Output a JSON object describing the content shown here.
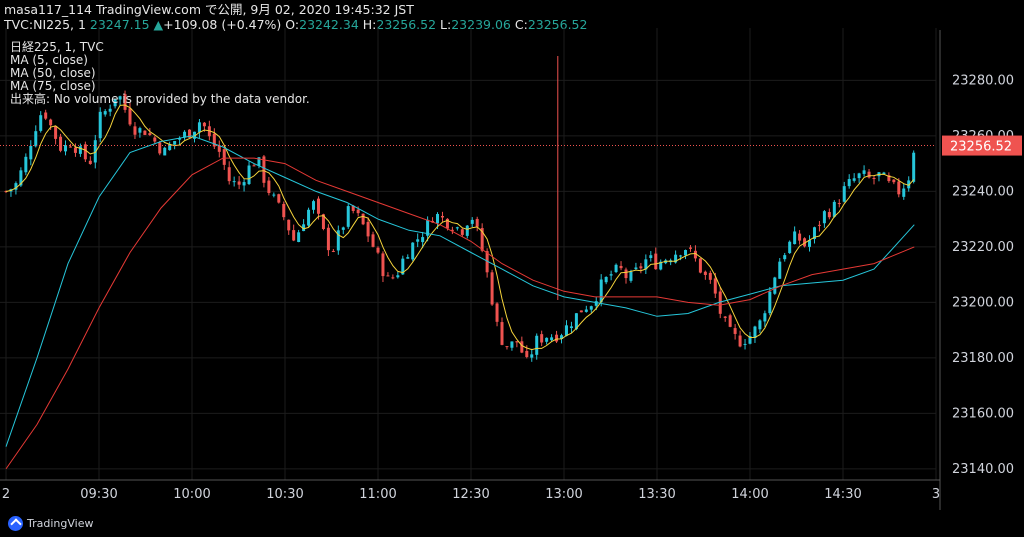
{
  "header": {
    "line1": "masa117_114 TradingView.com で公開, 9月 02, 2020 19:45:32 JST",
    "symbol_label": "TVC:NI225, 1",
    "last": "23247.15",
    "change_arrow": "▲",
    "change": "+109.08 (+0.47%)",
    "o_label": "O:",
    "o": "23242.34",
    "h_label": "H:",
    "h": "23256.52",
    "l_label": "L:",
    "l": "23239.06",
    "c_label": "C:",
    "c": "23256.52"
  },
  "overlay": {
    "title": "日経225, 1, TVC",
    "ma5": "MA (5, close)",
    "ma50": "MA (50, close)",
    "ma75": "MA (75, close)",
    "volume_note": "出来高: No volume is provided by the data vendor."
  },
  "footer": {
    "brand": "TradingView"
  },
  "colors": {
    "up": "#26c6da",
    "down": "#ef5350",
    "ma5": "#f5d33b",
    "ma50": "#26c6da",
    "ma75": "#e53935",
    "price_tag": "#ef5350",
    "grid": "#1c1c1c",
    "axis_text": "#d1d4dc"
  },
  "chart_data": {
    "type": "candlestick",
    "y_ticks": [
      "23140.00",
      "23160.00",
      "23180.00",
      "23200.00",
      "23220.00",
      "23240.00",
      "23260.00",
      "23280.00"
    ],
    "ylim": [
      23136,
      23296
    ],
    "x_ticks": [
      {
        "label": "2",
        "t": 0
      },
      {
        "label": "09:30",
        "t": 30
      },
      {
        "label": "10:00",
        "t": 60
      },
      {
        "label": "10:30",
        "t": 90
      },
      {
        "label": "11:00",
        "t": 120
      },
      {
        "label": "12:30",
        "t": 150
      },
      {
        "label": "13:00",
        "t": 180
      },
      {
        "label": "13:30",
        "t": 210
      },
      {
        "label": "14:00",
        "t": 240
      },
      {
        "label": "14:30",
        "t": 270
      },
      {
        "label": "3",
        "t": 300
      }
    ],
    "last_price": "23256.52",
    "close_path": [
      [
        0,
        23240
      ],
      [
        3,
        23242
      ],
      [
        6,
        23250
      ],
      [
        9,
        23262
      ],
      [
        12,
        23270
      ],
      [
        15,
        23262
      ],
      [
        18,
        23255
      ],
      [
        21,
        23258
      ],
      [
        24,
        23254
      ],
      [
        27,
        23250
      ],
      [
        30,
        23266
      ],
      [
        33,
        23270
      ],
      [
        36,
        23276
      ],
      [
        39,
        23268
      ],
      [
        42,
        23262
      ],
      [
        45,
        23262
      ],
      [
        48,
        23258
      ],
      [
        51,
        23254
      ],
      [
        54,
        23258
      ],
      [
        57,
        23260
      ],
      [
        60,
        23262
      ],
      [
        63,
        23266
      ],
      [
        66,
        23258
      ],
      [
        69,
        23254
      ],
      [
        72,
        23244
      ],
      [
        75,
        23242
      ],
      [
        78,
        23248
      ],
      [
        81,
        23252
      ],
      [
        84,
        23242
      ],
      [
        87,
        23236
      ],
      [
        90,
        23230
      ],
      [
        93,
        23222
      ],
      [
        96,
        23230
      ],
      [
        99,
        23236
      ],
      [
        102,
        23226
      ],
      [
        105,
        23218
      ],
      [
        108,
        23226
      ],
      [
        111,
        23234
      ],
      [
        114,
        23230
      ],
      [
        117,
        23224
      ],
      [
        120,
        23216
      ],
      [
        123,
        23208
      ],
      [
        126,
        23210
      ],
      [
        129,
        23218
      ],
      [
        132,
        23222
      ],
      [
        135,
        23226
      ],
      [
        138,
        23232
      ],
      [
        141,
        23230
      ],
      [
        144,
        23228
      ],
      [
        147,
        23226
      ],
      [
        150,
        23232
      ],
      [
        153,
        23222
      ],
      [
        156,
        23206
      ],
      [
        159,
        23188
      ],
      [
        162,
        23184
      ],
      [
        165,
        23186
      ],
      [
        168,
        23178
      ],
      [
        171,
        23186
      ],
      [
        174,
        23188
      ],
      [
        177,
        23188
      ],
      [
        180,
        23190
      ],
      [
        183,
        23194
      ],
      [
        186,
        23198
      ],
      [
        189,
        23200
      ],
      [
        192,
        23206
      ],
      [
        195,
        23210
      ],
      [
        198,
        23212
      ],
      [
        201,
        23208
      ],
      [
        204,
        23212
      ],
      [
        207,
        23216
      ],
      [
        210,
        23214
      ],
      [
        213,
        23216
      ],
      [
        216,
        23218
      ],
      [
        219,
        23220
      ],
      [
        222,
        23216
      ],
      [
        225,
        23210
      ],
      [
        228,
        23206
      ],
      [
        231,
        23194
      ],
      [
        234,
        23188
      ],
      [
        237,
        23186
      ],
      [
        240,
        23188
      ],
      [
        243,
        23192
      ],
      [
        246,
        23202
      ],
      [
        249,
        23214
      ],
      [
        252,
        23220
      ],
      [
        255,
        23224
      ],
      [
        258,
        23220
      ],
      [
        261,
        23226
      ],
      [
        264,
        23232
      ],
      [
        267,
        23234
      ],
      [
        270,
        23240
      ],
      [
        273,
        23244
      ],
      [
        276,
        23246
      ],
      [
        279,
        23244
      ],
      [
        282,
        23246
      ],
      [
        285,
        23242
      ],
      [
        288,
        23240
      ],
      [
        291,
        23244
      ],
      [
        293,
        23256.52
      ]
    ],
    "ma50_path": [
      [
        0,
        23148
      ],
      [
        10,
        23180
      ],
      [
        20,
        23214
      ],
      [
        30,
        23238
      ],
      [
        40,
        23254
      ],
      [
        50,
        23258
      ],
      [
        60,
        23260
      ],
      [
        70,
        23256
      ],
      [
        80,
        23250
      ],
      [
        90,
        23245
      ],
      [
        100,
        23240
      ],
      [
        110,
        23236
      ],
      [
        120,
        23230
      ],
      [
        130,
        23226
      ],
      [
        140,
        23224
      ],
      [
        150,
        23218
      ],
      [
        160,
        23212
      ],
      [
        170,
        23206
      ],
      [
        180,
        23202
      ],
      [
        190,
        23200
      ],
      [
        200,
        23198
      ],
      [
        210,
        23195
      ],
      [
        220,
        23196
      ],
      [
        230,
        23200
      ],
      [
        240,
        23203
      ],
      [
        250,
        23206
      ],
      [
        260,
        23207
      ],
      [
        270,
        23208
      ],
      [
        280,
        23212
      ],
      [
        293,
        23228
      ]
    ],
    "ma75_path": [
      [
        0,
        23140
      ],
      [
        10,
        23156
      ],
      [
        20,
        23176
      ],
      [
        30,
        23198
      ],
      [
        40,
        23218
      ],
      [
        50,
        23234
      ],
      [
        60,
        23246
      ],
      [
        70,
        23252
      ],
      [
        80,
        23252
      ],
      [
        90,
        23250
      ],
      [
        100,
        23244
      ],
      [
        110,
        23240
      ],
      [
        120,
        23236
      ],
      [
        130,
        23232
      ],
      [
        140,
        23228
      ],
      [
        150,
        23222
      ],
      [
        160,
        23214
      ],
      [
        170,
        23208
      ],
      [
        180,
        23204
      ],
      [
        190,
        23202
      ],
      [
        200,
        23202
      ],
      [
        210,
        23202
      ],
      [
        220,
        23200
      ],
      [
        230,
        23199
      ],
      [
        240,
        23201
      ],
      [
        250,
        23206
      ],
      [
        260,
        23210
      ],
      [
        270,
        23212
      ],
      [
        280,
        23214
      ],
      [
        293,
        23220
      ]
    ],
    "crosshair_t": 178
  }
}
